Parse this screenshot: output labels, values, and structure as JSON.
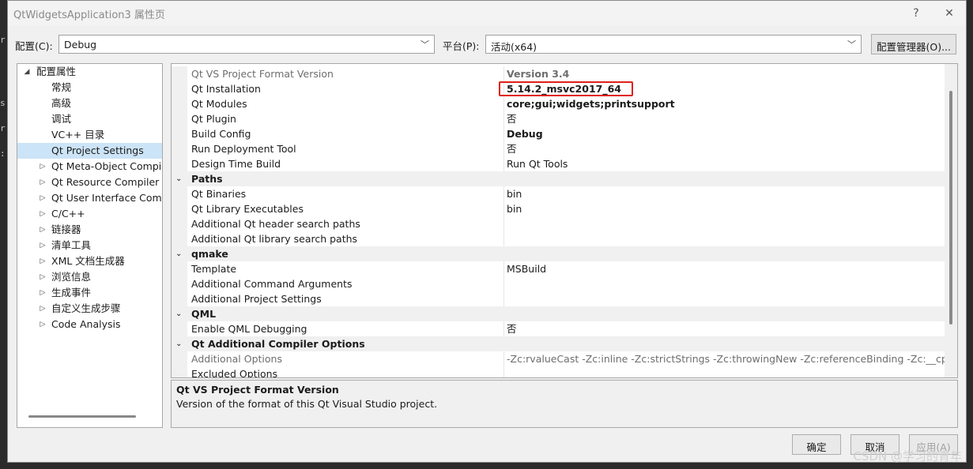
{
  "window": {
    "title": "QtWidgetsApplication3 属性页",
    "help_glyph": "?",
    "close_glyph": "✕"
  },
  "config": {
    "config_label": "配置(C):",
    "config_value": "Debug",
    "platform_label": "平台(P):",
    "platform_value": "活动(x64)",
    "manager_label": "配置管理器(O)..."
  },
  "tree": {
    "root": "配置属性",
    "items": [
      "常规",
      "高级",
      "调试",
      "VC++ 目录",
      "Qt Project Settings",
      "Qt Meta-Object Compiler",
      "Qt Resource Compiler",
      "Qt User Interface Compiler",
      "C/C++",
      "链接器",
      "清单工具",
      "XML 文档生成器",
      "浏览信息",
      "生成事件",
      "自定义生成步骤",
      "Code Analysis"
    ]
  },
  "grid": {
    "rows": [
      {
        "name": "Qt VS Project Format Version",
        "value": "Version 3.4"
      },
      {
        "name": "Qt Installation",
        "value": "5.14.2_msvc2017_64"
      },
      {
        "name": "Qt Modules",
        "value": "core;gui;widgets;printsupport"
      },
      {
        "name": "Qt Plugin",
        "value": "否"
      },
      {
        "name": "Build Config",
        "value": "Debug"
      },
      {
        "name": "Run Deployment Tool",
        "value": "否"
      },
      {
        "name": "Design Time Build",
        "value": "Run Qt Tools"
      },
      {
        "name": "Paths"
      },
      {
        "name": "Qt Binaries",
        "value": "bin"
      },
      {
        "name": "Qt Library Executables",
        "value": "bin"
      },
      {
        "name": "Additional Qt header search paths",
        "value": ""
      },
      {
        "name": "Additional Qt library search paths",
        "value": ""
      },
      {
        "name": "qmake"
      },
      {
        "name": "Template",
        "value": "MSBuild"
      },
      {
        "name": "Additional Command Arguments",
        "value": ""
      },
      {
        "name": "Additional Project Settings",
        "value": ""
      },
      {
        "name": "QML"
      },
      {
        "name": "Enable QML Debugging",
        "value": "否"
      },
      {
        "name": "Qt Additional Compiler Options"
      },
      {
        "name": "Additional Options",
        "value": "-Zc:rvalueCast -Zc:inline -Zc:strictStrings -Zc:throwingNew -Zc:referenceBinding -Zc:__cplusplus"
      },
      {
        "name": "Excluded Options",
        "value": ""
      }
    ]
  },
  "description": {
    "title": "Qt VS Project Format Version",
    "text": "Version of the format of this Qt Visual Studio project."
  },
  "buttons": {
    "ok": "确定",
    "cancel": "取消",
    "apply": "应用(A)"
  },
  "watermark": "CSDN @学习的青年",
  "colors": {
    "selection": "#cce4f7",
    "highlight_box": "#e0201c"
  }
}
